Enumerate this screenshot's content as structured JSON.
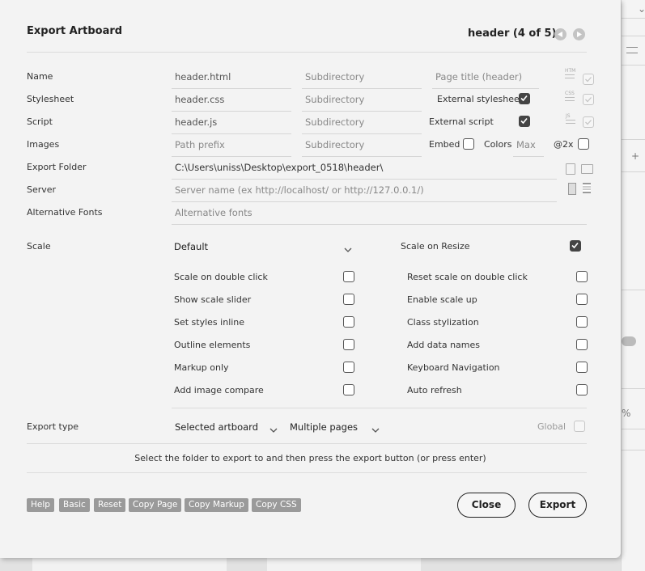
{
  "dialog": {
    "title": "Export Artboard",
    "page_indicator": "header (4 of 5)"
  },
  "rows": {
    "name": {
      "label": "Name",
      "file": "header.html",
      "subdir": "Subdirectory",
      "extra": "Page title (header)",
      "icon": "html-icon",
      "icon_text": "HTM"
    },
    "stylesheet": {
      "label": "Stylesheet",
      "file": "header.css",
      "subdir": "Subdirectory",
      "extra": "External stylesheet",
      "checked": true,
      "icon": "css-icon",
      "icon_text": "CSS"
    },
    "script": {
      "label": "Script",
      "file": "header.js",
      "subdir": "Subdirectory",
      "extra": "External script",
      "checked": true,
      "icon": "js-icon",
      "icon_text": "JS"
    },
    "images": {
      "label": "Images",
      "path_prefix": "Path prefix",
      "subdir": "Subdirectory",
      "embed_label": "Embed",
      "embed_checked": false,
      "colors_label": "Colors",
      "colors_placeholder": "Max",
      "x2_label": "@2x",
      "x2_checked": false
    },
    "export_folder": {
      "label": "Export Folder",
      "value": "C:\\Users\\uniss\\Desktop\\export_0518\\header\\"
    },
    "server": {
      "label": "Server",
      "placeholder": "Server name (ex http://localhost/ or http://127.0.0.1/)"
    },
    "alt_fonts": {
      "label": "Alternative Fonts",
      "placeholder": "Alternative fonts"
    }
  },
  "scale": {
    "label": "Scale",
    "selected": "Default",
    "on_resize_label": "Scale on Resize",
    "on_resize_checked": true
  },
  "options_left": [
    {
      "label": "Scale on double click",
      "checked": false
    },
    {
      "label": "Show scale slider",
      "checked": false
    },
    {
      "label": "Set styles inline",
      "checked": false
    },
    {
      "label": "Outline elements",
      "checked": false
    },
    {
      "label": "Markup only",
      "checked": false
    },
    {
      "label": "Add image compare",
      "checked": false
    }
  ],
  "options_right": [
    {
      "label": "Reset scale on double click",
      "checked": false
    },
    {
      "label": "Enable scale up",
      "checked": false
    },
    {
      "label": "Class stylization",
      "checked": false
    },
    {
      "label": "Add data names",
      "checked": false
    },
    {
      "label": "Keyboard Navigation",
      "checked": false
    },
    {
      "label": "Auto refresh",
      "checked": false
    }
  ],
  "export_type": {
    "label": "Export type",
    "artboards": "Selected artboard",
    "pages": "Multiple pages",
    "global_label": "Global",
    "global_checked": false
  },
  "hint": "Select the folder to export to and then press the export button (or press enter)",
  "footer_buttons": [
    "Help",
    "Basic",
    "Reset",
    "Copy Page",
    "Copy Markup",
    "Copy CSS"
  ],
  "close_label": "Close",
  "export_label": "Export",
  "background": {
    "right_panel_glyphs": [
      "⌄",
      "+",
      "%"
    ]
  }
}
